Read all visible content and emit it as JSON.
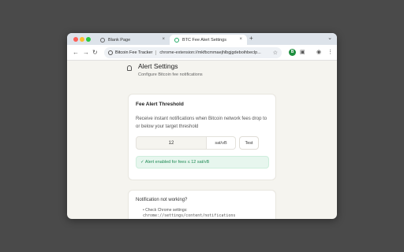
{
  "browser": {
    "tabs": [
      {
        "title": "Blank Page",
        "active": false
      },
      {
        "title": "BTC Fee Alert Settings",
        "active": true
      }
    ],
    "new_tab_label": "+",
    "tab_close_glyph": "×",
    "address_bar": {
      "chip": "Bitcoin Fee Tracker",
      "url": "chrome-extension://mkfbcmmaejhlbgjgdeboihbeclp..."
    },
    "extension_badge": "B"
  },
  "page": {
    "title": "Alert Settings",
    "subtitle": "Configure Bitcoin fee notifications"
  },
  "threshold_card": {
    "title": "Fee Alert Threshold",
    "description": "Receive instant notifications when Bitcoin network fees drop to or below your target threshold",
    "input_value": "12",
    "unit": "sat/vB",
    "test_button": "Test",
    "status": "✓ Alert enabled for fees ≤ 12 sat/vB",
    "status_color": "#1f8a55"
  },
  "help_card": {
    "title": "Notification not working?",
    "items": [
      "• Check Chrome settings:",
      "chrome://settings/content/notifications"
    ]
  }
}
